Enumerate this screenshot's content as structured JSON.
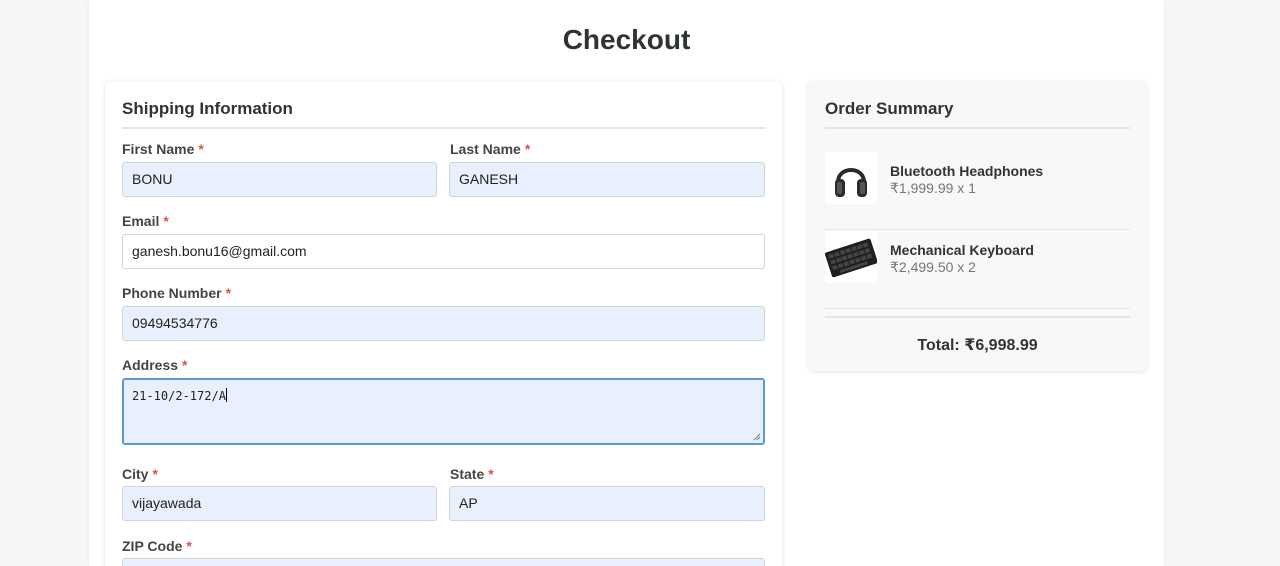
{
  "page_title": "Checkout",
  "shipping": {
    "title": "Shipping Information",
    "required_marker": "*",
    "first_name": {
      "label": "First Name",
      "value": "BONU"
    },
    "last_name": {
      "label": "Last Name",
      "value": "GANESH"
    },
    "email": {
      "label": "Email",
      "value": "ganesh.bonu16@gmail.com"
    },
    "phone": {
      "label": "Phone Number",
      "value": "09494534776"
    },
    "address": {
      "label": "Address",
      "value": "21-10/2-172/A"
    },
    "city": {
      "label": "City",
      "value": "vijayawada"
    },
    "state": {
      "label": "State",
      "value": "AP"
    },
    "zip": {
      "label": "ZIP Code",
      "value": ""
    }
  },
  "summary": {
    "title": "Order Summary",
    "items": [
      {
        "name": "Bluetooth Headphones",
        "price": "₹1,999.99 x 1",
        "icon": "headphones-icon"
      },
      {
        "name": "Mechanical Keyboard",
        "price": "₹2,499.50 x 2",
        "icon": "keyboard-icon"
      }
    ],
    "total": "Total: ₹6,998.99"
  },
  "colors": {
    "autofill_bg": "#e8f0fe",
    "required": "#d9534f",
    "focus_border": "#5b9bd5"
  }
}
